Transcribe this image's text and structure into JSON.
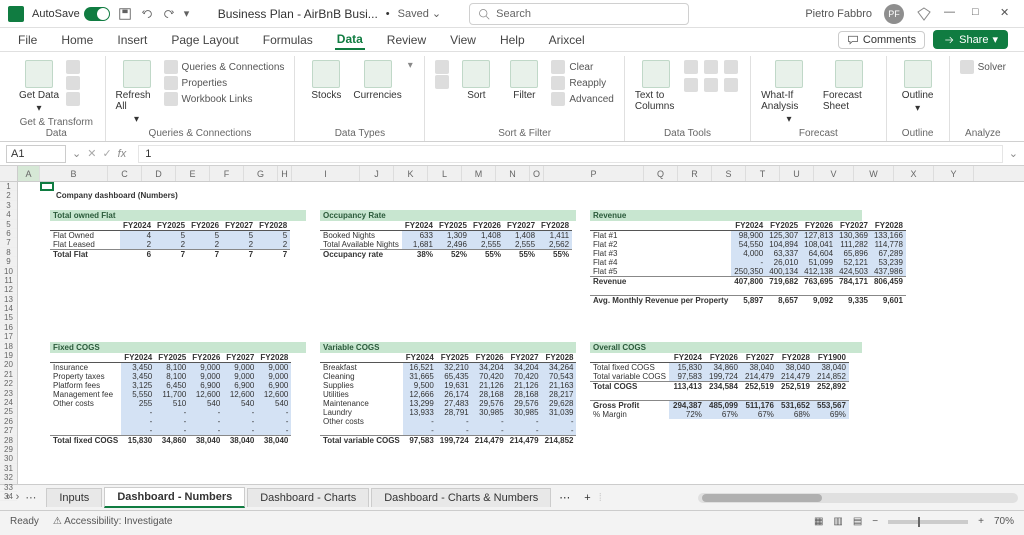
{
  "titlebar": {
    "autosave": "AutoSave",
    "doc_name": "Business Plan - AirBnB Busi...",
    "saved": "Saved",
    "search_placeholder": "Search",
    "user_name": "Pietro Fabbro",
    "user_initials": "PF"
  },
  "menu": {
    "tabs": [
      "File",
      "Home",
      "Insert",
      "Page Layout",
      "Formulas",
      "Data",
      "Review",
      "View",
      "Help",
      "Arixcel"
    ],
    "active": "Data",
    "comments": "Comments",
    "share": "Share"
  },
  "ribbon": {
    "groups": {
      "get_transform": {
        "label": "Get & Transform Data",
        "get_data": "Get Data"
      },
      "queries": {
        "label": "Queries & Connections",
        "refresh": "Refresh All",
        "qc": "Queries & Connections",
        "props": "Properties",
        "wl": "Workbook Links"
      },
      "data_types": {
        "label": "Data Types",
        "stocks": "Stocks",
        "currencies": "Currencies"
      },
      "sort_filter": {
        "label": "Sort & Filter",
        "sort": "Sort",
        "filter": "Filter",
        "clear": "Clear",
        "reapply": "Reapply",
        "advanced": "Advanced"
      },
      "data_tools": {
        "label": "Data Tools",
        "ttc": "Text to Columns"
      },
      "forecast": {
        "label": "Forecast",
        "whatif": "What-If Analysis",
        "sheet": "Forecast Sheet"
      },
      "outline": {
        "label": "Outline",
        "outline": "Outline"
      },
      "analyze": {
        "label": "Analyze",
        "solver": "Solver"
      }
    }
  },
  "formula_bar": {
    "name_box": "A1",
    "value": "1"
  },
  "dashboard_title": "Company dashboard (Numbers)",
  "years": [
    "FY2024",
    "FY2025",
    "FY2026",
    "FY2027",
    "FY2028"
  ],
  "years_cogs_overall": [
    "FY2024",
    "FY2026",
    "FY2027",
    "FY2028",
    "FY1900"
  ],
  "sections": {
    "owned_flat": {
      "title": "Total owned Flat",
      "rows": [
        {
          "lbl": "Flat Owned",
          "vals": [
            "4",
            "5",
            "5",
            "5",
            "5"
          ]
        },
        {
          "lbl": "Flat Leased",
          "vals": [
            "2",
            "2",
            "2",
            "2",
            "2"
          ]
        }
      ],
      "total": {
        "lbl": "Total Flat",
        "vals": [
          "6",
          "7",
          "7",
          "7",
          "7"
        ]
      }
    },
    "occupancy": {
      "title": "Occupancy Rate",
      "rows": [
        {
          "lbl": "Booked Nights",
          "vals": [
            "633",
            "1,309",
            "1,408",
            "1,408",
            "1,411"
          ]
        },
        {
          "lbl": "Total Available Nights",
          "vals": [
            "1,681",
            "2,496",
            "2,555",
            "2,555",
            "2,562"
          ]
        }
      ],
      "total": {
        "lbl": "Occupancy rate",
        "vals": [
          "38%",
          "52%",
          "55%",
          "55%",
          "55%"
        ]
      }
    },
    "revenue": {
      "title": "Revenue",
      "rows": [
        {
          "lbl": "Flat #1",
          "vals": [
            "98,900",
            "125,307",
            "127,813",
            "130,369",
            "133,166"
          ]
        },
        {
          "lbl": "Flat #2",
          "vals": [
            "54,550",
            "104,894",
            "108,041",
            "111,282",
            "114,778"
          ]
        },
        {
          "lbl": "Flat #3",
          "vals": [
            "4,000",
            "63,337",
            "64,604",
            "65,896",
            "67,289"
          ]
        },
        {
          "lbl": "Flat #4",
          "vals": [
            "-",
            "26,010",
            "51,099",
            "52,121",
            "53,239"
          ]
        },
        {
          "lbl": "Flat #5",
          "vals": [
            "250,350",
            "400,134",
            "412,138",
            "424,503",
            "437,986"
          ]
        }
      ],
      "total": {
        "lbl": "Revenue",
        "vals": [
          "407,800",
          "719,682",
          "763,695",
          "784,171",
          "806,459"
        ]
      },
      "avg": {
        "lbl": "Avg. Monthly Revenue per Property",
        "vals": [
          "5,897",
          "8,657",
          "9,092",
          "9,335",
          "9,601"
        ]
      }
    },
    "fixed_cogs": {
      "title": "Fixed COGS",
      "rows": [
        {
          "lbl": "Insurance",
          "vals": [
            "3,450",
            "8,100",
            "9,000",
            "9,000",
            "9,000"
          ]
        },
        {
          "lbl": "Property taxes",
          "vals": [
            "3,450",
            "8,100",
            "9,000",
            "9,000",
            "9,000"
          ]
        },
        {
          "lbl": "Platform fees",
          "vals": [
            "3,125",
            "6,450",
            "6,900",
            "6,900",
            "6,900"
          ]
        },
        {
          "lbl": "Management fee",
          "vals": [
            "5,550",
            "11,700",
            "12,600",
            "12,600",
            "12,600"
          ]
        },
        {
          "lbl": "Other costs",
          "vals": [
            "255",
            "510",
            "540",
            "540",
            "540"
          ]
        },
        {
          "lbl": "",
          "vals": [
            "-",
            "-",
            "-",
            "-",
            "-"
          ]
        },
        {
          "lbl": "",
          "vals": [
            "-",
            "-",
            "-",
            "-",
            "-"
          ]
        },
        {
          "lbl": "",
          "vals": [
            "-",
            "-",
            "-",
            "-",
            "-"
          ]
        }
      ],
      "total": {
        "lbl": "Total fixed COGS",
        "vals": [
          "15,830",
          "34,860",
          "38,040",
          "38,040",
          "38,040"
        ]
      }
    },
    "variable_cogs": {
      "title": "Variable COGS",
      "rows": [
        {
          "lbl": "Breakfast",
          "vals": [
            "16,521",
            "32,210",
            "34,204",
            "34,204",
            "34,264"
          ]
        },
        {
          "lbl": "Cleaning",
          "vals": [
            "31,665",
            "65,435",
            "70,420",
            "70,420",
            "70,543"
          ]
        },
        {
          "lbl": "Supplies",
          "vals": [
            "9,500",
            "19,631",
            "21,126",
            "21,126",
            "21,163"
          ]
        },
        {
          "lbl": "Utilities",
          "vals": [
            "12,666",
            "26,174",
            "28,168",
            "28,168",
            "28,217"
          ]
        },
        {
          "lbl": "Maintenance",
          "vals": [
            "13,299",
            "27,483",
            "29,576",
            "29,576",
            "29,628"
          ]
        },
        {
          "lbl": "Laundry",
          "vals": [
            "13,933",
            "28,791",
            "30,985",
            "30,985",
            "31,039"
          ]
        },
        {
          "lbl": "Other costs",
          "vals": [
            "-",
            "-",
            "-",
            "-",
            "-"
          ]
        },
        {
          "lbl": "",
          "vals": [
            "-",
            "-",
            "-",
            "-",
            "-"
          ]
        }
      ],
      "total": {
        "lbl": "Total variable COGS",
        "vals": [
          "97,583",
          "199,724",
          "214,479",
          "214,479",
          "214,852"
        ]
      }
    },
    "overall_cogs": {
      "title": "Overall COGS",
      "rows": [
        {
          "lbl": "Total fixed COGS",
          "vals": [
            "15,830",
            "34,860",
            "38,040",
            "38,040",
            "38,040"
          ]
        },
        {
          "lbl": "Total variable COGS",
          "vals": [
            "97,583",
            "199,724",
            "214,479",
            "214,479",
            "214,852"
          ]
        }
      ],
      "total": {
        "lbl": "Total COGS",
        "vals": [
          "113,413",
          "234,584",
          "252,519",
          "252,519",
          "252,892"
        ]
      },
      "gross": {
        "lbl": "Gross Profit",
        "vals": [
          "294,387",
          "485,099",
          "511,176",
          "531,652",
          "553,567"
        ]
      },
      "margin": {
        "lbl": "% Margin",
        "vals": [
          "72%",
          "67%",
          "67%",
          "68%",
          "69%"
        ]
      }
    }
  },
  "sheet_tabs": [
    "Inputs",
    "Dashboard - Numbers",
    "Dashboard - Charts",
    "Dashboard - Charts & Numbers"
  ],
  "sheet_tab_active": "Dashboard - Numbers",
  "statusbar": {
    "ready": "Ready",
    "access": "Accessibility: Investigate",
    "zoom": "70%"
  },
  "columns": [
    "A",
    "B",
    "C",
    "D",
    "E",
    "F",
    "G",
    "H",
    "I",
    "J",
    "K",
    "L",
    "M",
    "N",
    "O",
    "P",
    "Q",
    "R",
    "S",
    "T",
    "U",
    "V",
    "W",
    "X",
    "Y"
  ]
}
